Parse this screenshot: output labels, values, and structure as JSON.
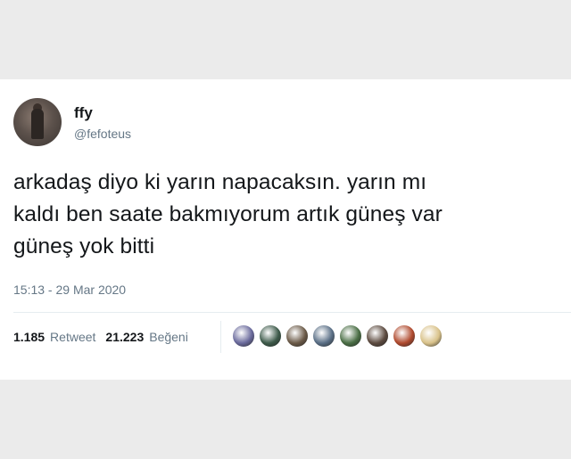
{
  "tweet": {
    "display_name": "ffy",
    "handle": "@fefoteus",
    "text_lines": [
      "arkadaş diyo ki yarın napacaksın. yarın mı",
      "kaldı ben saate bakmıyorum artık güneş var",
      "güneş yok bitti"
    ],
    "timestamp": "15:13 - 29 Mar 2020"
  },
  "stats": {
    "retweets_count": "1.185",
    "retweets_label": "Retweet",
    "likes_count": "21.223",
    "likes_label": "Beğeni"
  },
  "likers": [
    {
      "color": "#6a6a9c"
    },
    {
      "color": "#3d5a4a"
    },
    {
      "color": "#6b5a48"
    },
    {
      "color": "#5a6f86"
    },
    {
      "color": "#4a6e45"
    },
    {
      "color": "#5c4a3f"
    },
    {
      "color": "#b04a2e"
    },
    {
      "color": "#d9c28a"
    }
  ]
}
